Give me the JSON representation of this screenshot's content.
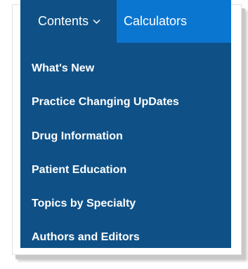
{
  "nav": {
    "contents_label": "Contents",
    "calculators_label": "Calculators",
    "chevron_icon": "chevron-down-icon",
    "contents_bg": "#0f5187",
    "calculators_bg": "#0b76d0"
  },
  "dropdown": {
    "items": [
      {
        "label": "What's New"
      },
      {
        "label": "Practice Changing UpDates"
      },
      {
        "label": "Drug Information"
      },
      {
        "label": "Patient Education"
      },
      {
        "label": "Topics by Specialty"
      },
      {
        "label": "Authors and Editors"
      }
    ]
  }
}
